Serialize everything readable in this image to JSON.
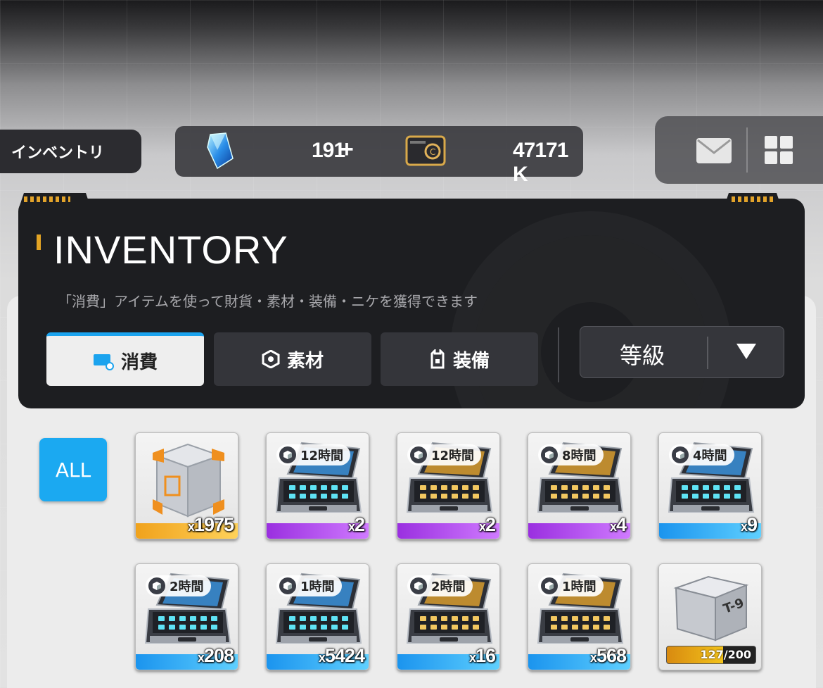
{
  "header": {
    "title": "インベントリ"
  },
  "currencies": [
    {
      "icon": "gem-icon",
      "value": "191",
      "add": "+"
    },
    {
      "icon": "credit-card-icon",
      "value": "47171 K"
    }
  ],
  "utility": {
    "mail_icon": "mail-icon",
    "menu_icon": "grid-menu-icon"
  },
  "panel": {
    "title": "INVENTORY",
    "description": "「消費」アイテムを使って財貨・素材・装備・ニケを獲得できます"
  },
  "tabs": [
    {
      "label": "消費",
      "icon": "consumable-icon",
      "active": true
    },
    {
      "label": "素材",
      "icon": "hexagon-icon",
      "active": false
    },
    {
      "label": "装備",
      "icon": "equipment-icon",
      "active": false
    }
  ],
  "sort": {
    "label": "等級"
  },
  "filter": {
    "all_label": "ALL"
  },
  "colors": {
    "accent": "#1ba9f1",
    "gold": "#e3a424",
    "purple": "#a43ee6",
    "blue": "#25a6ef"
  },
  "items": [
    {
      "name": "crate",
      "count": "1975",
      "prefix": "x",
      "rarity": "gold"
    },
    {
      "name": "case",
      "timer": "12時間",
      "count": "2",
      "prefix": "x",
      "rarity": "purple",
      "case_color": "blue"
    },
    {
      "name": "case",
      "timer": "12時間",
      "count": "2",
      "prefix": "x",
      "rarity": "purple",
      "case_color": "gold"
    },
    {
      "name": "case",
      "timer": "8時間",
      "count": "4",
      "prefix": "x",
      "rarity": "purple",
      "case_color": "gold"
    },
    {
      "name": "case",
      "timer": "4時間",
      "count": "9",
      "prefix": "x",
      "rarity": "blue",
      "case_color": "blue"
    },
    {
      "name": "case",
      "timer": "2時間",
      "count": "208",
      "prefix": "x",
      "rarity": "blue",
      "case_color": "blue"
    },
    {
      "name": "case",
      "timer": "1時間",
      "count": "5424",
      "prefix": "x",
      "rarity": "blue",
      "case_color": "blue"
    },
    {
      "name": "case",
      "timer": "2時間",
      "count": "16",
      "prefix": "x",
      "rarity": "blue",
      "case_color": "gold"
    },
    {
      "name": "case",
      "timer": "1時間",
      "count": "568",
      "prefix": "x",
      "rarity": "blue",
      "case_color": "gold"
    },
    {
      "name": "box",
      "progress_text": "127/200",
      "progress": 0.635,
      "rarity": "none"
    }
  ]
}
